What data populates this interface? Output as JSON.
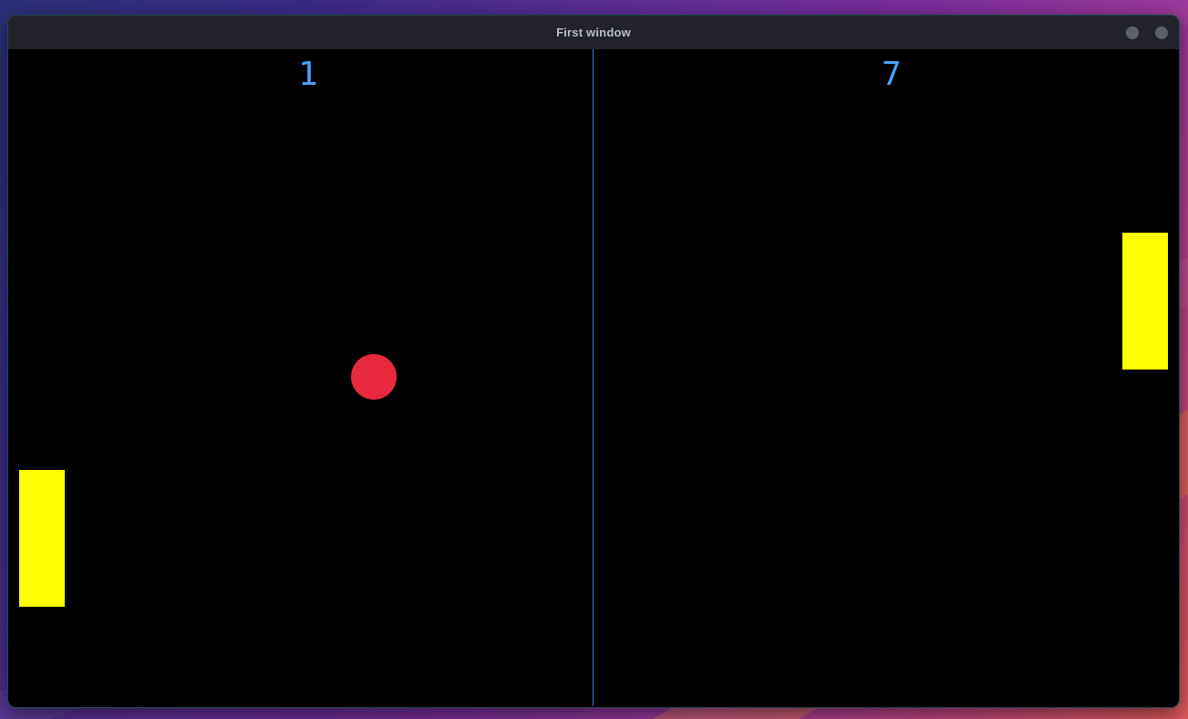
{
  "window": {
    "title": "First window"
  },
  "game": {
    "score_left": "1",
    "score_right": "7",
    "colors": {
      "background": "#000000",
      "paddle": "#ffff00",
      "ball": "#e8283c",
      "net": "#4d6fe0",
      "score": "#4aa3ff"
    }
  }
}
